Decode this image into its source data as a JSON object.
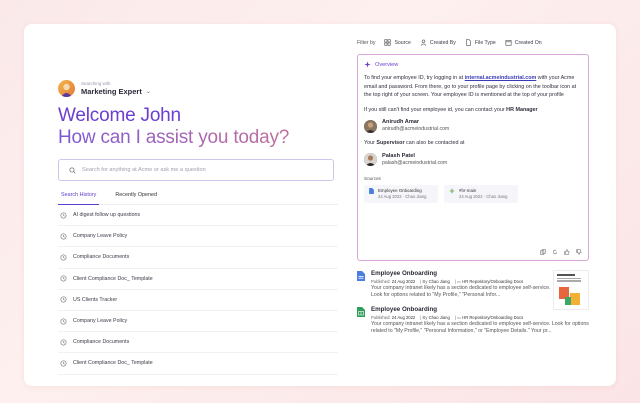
{
  "agent": {
    "sublabel": "Searching with",
    "name": "Marketing Expert"
  },
  "hero": {
    "greeting": "Welcome John",
    "question": "How can I assist you today?"
  },
  "search": {
    "placeholder": "Search for anything at Acme or ask me a question"
  },
  "tabs": [
    {
      "label": "Search History",
      "active": true
    },
    {
      "label": "Recently Opened",
      "active": false
    }
  ],
  "history": [
    "AI digest follow up questions",
    "Company Leave Policy",
    "Compliance Documents",
    "Client Compliance Doc_ Template",
    "US Clients Tracker",
    "Company Leave Policy",
    "Compliance Documents",
    "Client Compliance Doc_ Template"
  ],
  "filters": {
    "label": "Filter by",
    "items": [
      "Source",
      "Created By",
      "File Type",
      "Created On"
    ]
  },
  "overview": {
    "title": "Overview",
    "p1_a": "To find your employee ID, try logging in at ",
    "p1_link": "internal.acmeindustrial.com",
    "p1_b": " with your Acme email and password. From there, go to your profile page by clicking on the toolbar icon at the top right of your screen. Your employee ID is mentioned at the top of your profile",
    "p2_a": "If you still can't find your employee id, you can contact your ",
    "p2_b": "HR Manager",
    "person1": {
      "name": "Anirudh Amar",
      "email": "anirudh@acmeindustrial.com"
    },
    "p3_a": "Your ",
    "p3_b": "Supervisor",
    "p3_c": " can also be contacted at",
    "person2": {
      "name": "Palash Patel",
      "email": "palash@acmeindustrial.com"
    },
    "sources_label": "Sources",
    "sources": [
      {
        "title": "Employee Onboarding",
        "date": "24 Aug 2022",
        "author": "Chao Jiang"
      },
      {
        "title": "#hr-main",
        "date": "24 Aug 2022",
        "author": "Chao Jiang"
      }
    ]
  },
  "results": [
    {
      "title": "Employee Onboarding",
      "published_label": "Published:",
      "published": "24 Aug 2022",
      "by_label": "By",
      "author": "Chao Jiang",
      "path": "HR Repository/Onboarding Docs",
      "snippet": "Your company intranet likely has a section dedicated to employee self-service. Look for options related to \"My Profile,\" \"Personal Infor...",
      "icon_color": "#4a7fe0"
    },
    {
      "title": "Employee Onboarding",
      "published_label": "Published:",
      "published": "24 Aug 2022",
      "by_label": "By",
      "author": "Chao Jiang",
      "path": "HR Repository/Onboarding Docs",
      "snippet": "Your company intranet likely has a section dedicated to employee self-service. Look for options related to \"My Profile,\" \"Personal Information,\" or \"Employee Details.\" Your pr...",
      "icon_color": "#2f9e5a"
    }
  ],
  "colors": {
    "accent": "#6b3fd0",
    "overview_border": "#d9a7d9"
  }
}
